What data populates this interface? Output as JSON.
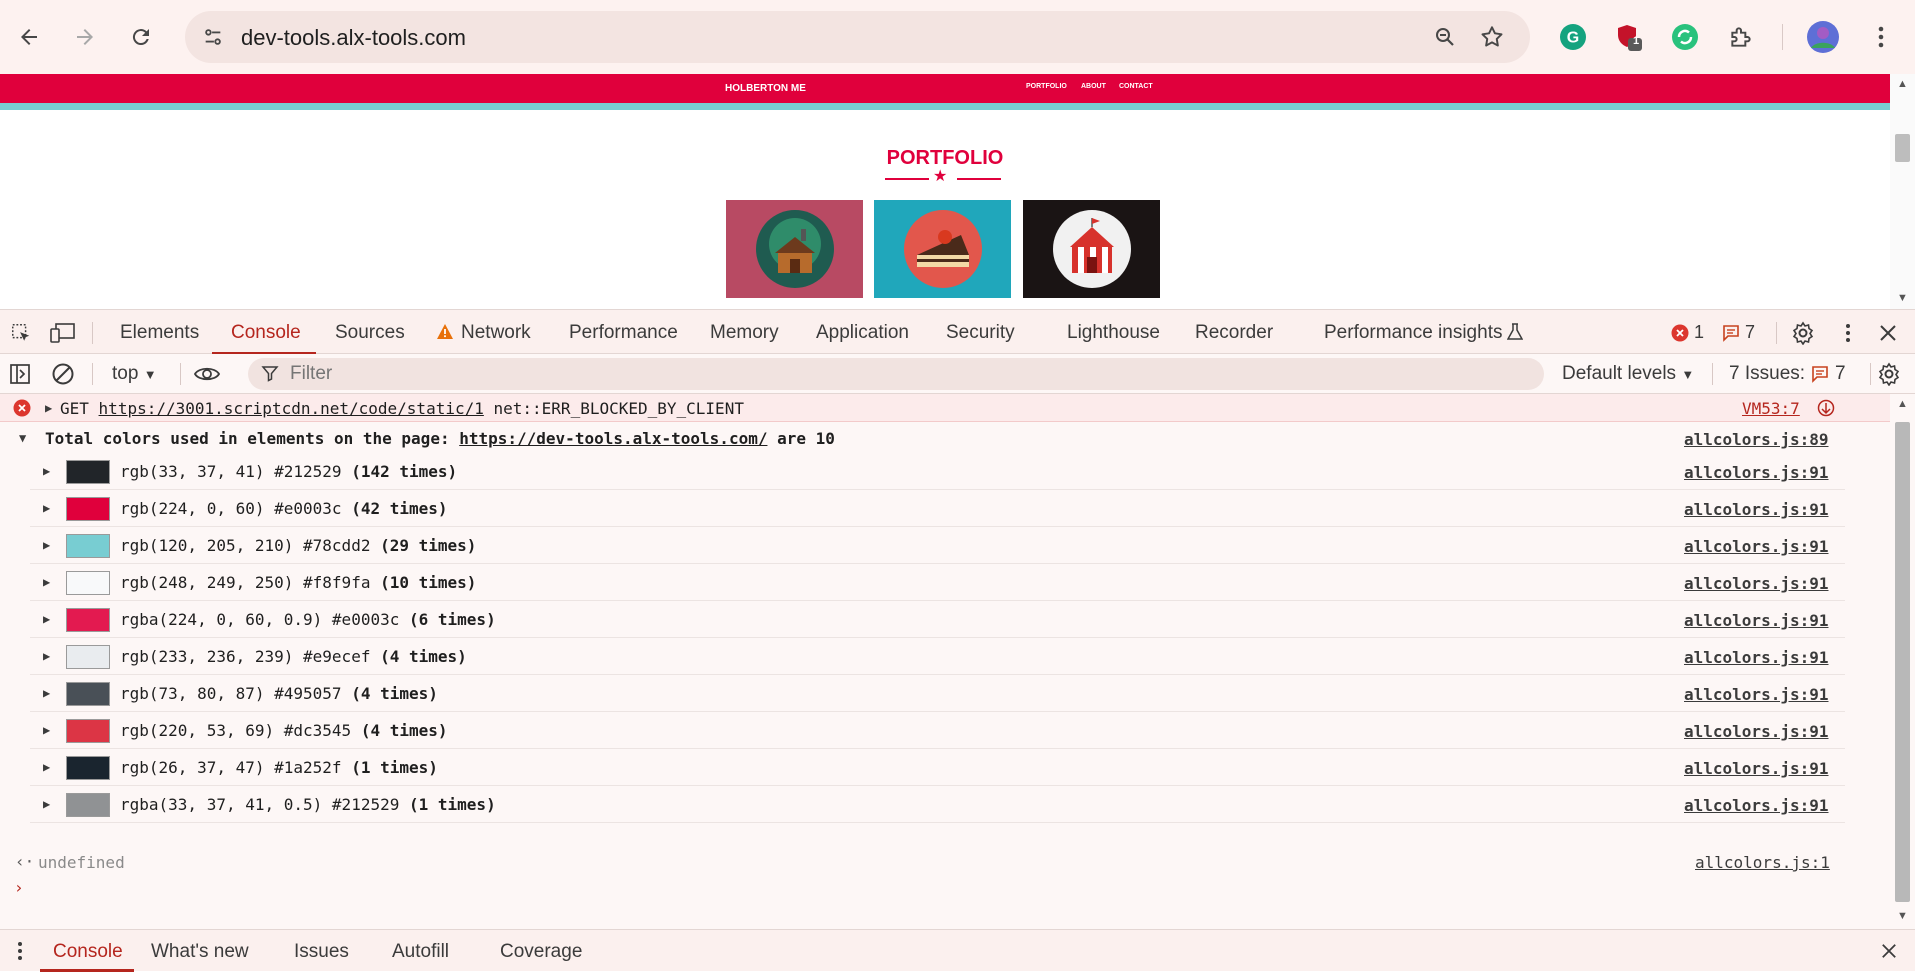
{
  "browser": {
    "url": "dev-tools.alx-tools.com",
    "extension_badge": "1"
  },
  "site": {
    "brand": "HOLBERTON ME",
    "nav": [
      "PORTFOLIO",
      "ABOUT",
      "CONTACT"
    ],
    "section_title": "PORTFOLIO",
    "tiles": [
      {
        "bg": "#b84a63",
        "icon": "cabin-icon"
      },
      {
        "bg": "#20a7bb",
        "icon": "cake-icon"
      },
      {
        "bg": "#1a1414",
        "icon": "circus-tent-icon"
      }
    ]
  },
  "devtools": {
    "tabs": [
      "Elements",
      "Console",
      "Sources",
      "Network",
      "Performance",
      "Memory",
      "Application",
      "Security",
      "Lighthouse",
      "Recorder",
      "Performance insights"
    ],
    "active_tab": "Console",
    "error_count": "1",
    "message_count": "7",
    "toolbar": {
      "context": "top",
      "filter_placeholder": "Filter",
      "levels": "Default levels",
      "issues_label": "7 Issues:",
      "issues_count": "7"
    },
    "console": {
      "error": {
        "method": "GET",
        "url": "https://3001.scriptcdn.net/code/static/1",
        "message": "net::ERR_BLOCKED_BY_CLIENT",
        "source": "VM53:7"
      },
      "group": {
        "prefix": "Total colors used in elements on the page:",
        "url": "https://dev-tools.alx-tools.com/",
        "suffix": "are 10",
        "source": "allcolors.js:89"
      },
      "colors": [
        {
          "swatch": "#212529",
          "value": "rgb(33, 37, 41) #212529",
          "count": "(142 times)",
          "source": "allcolors.js:91"
        },
        {
          "swatch": "#e0003c",
          "value": "rgb(224, 0, 60) #e0003c",
          "count": "(42 times)",
          "source": "allcolors.js:91"
        },
        {
          "swatch": "#78cdd2",
          "value": "rgb(120, 205, 210) #78cdd2",
          "count": "(29 times)",
          "source": "allcolors.js:91"
        },
        {
          "swatch": "#f8f9fa",
          "value": "rgb(248, 249, 250) #f8f9fa",
          "count": "(10 times)",
          "source": "allcolors.js:91"
        },
        {
          "swatch": "#e31a50",
          "value": "rgba(224, 0, 60, 0.9) #e0003c",
          "count": "(6 times)",
          "source": "allcolors.js:91"
        },
        {
          "swatch": "#e9ecef",
          "value": "rgb(233, 236, 239) #e9ecef",
          "count": "(4 times)",
          "source": "allcolors.js:91"
        },
        {
          "swatch": "#495057",
          "value": "rgb(73, 80, 87) #495057",
          "count": "(4 times)",
          "source": "allcolors.js:91"
        },
        {
          "swatch": "#dc3545",
          "value": "rgb(220, 53, 69) #dc3545",
          "count": "(4 times)",
          "source": "allcolors.js:91"
        },
        {
          "swatch": "#1a252f",
          "value": "rgb(26, 37, 47) #1a252f",
          "count": "(1 times)",
          "source": "allcolors.js:91"
        },
        {
          "swatch": "#909294",
          "value": "rgba(33, 37, 41, 0.5) #212529",
          "count": "(1 times)",
          "source": "allcolors.js:91"
        }
      ],
      "return_value": "undefined",
      "return_source": "allcolors.js:1"
    },
    "drawer_tabs": [
      "Console",
      "What's new",
      "Issues",
      "Autofill",
      "Coverage"
    ]
  }
}
